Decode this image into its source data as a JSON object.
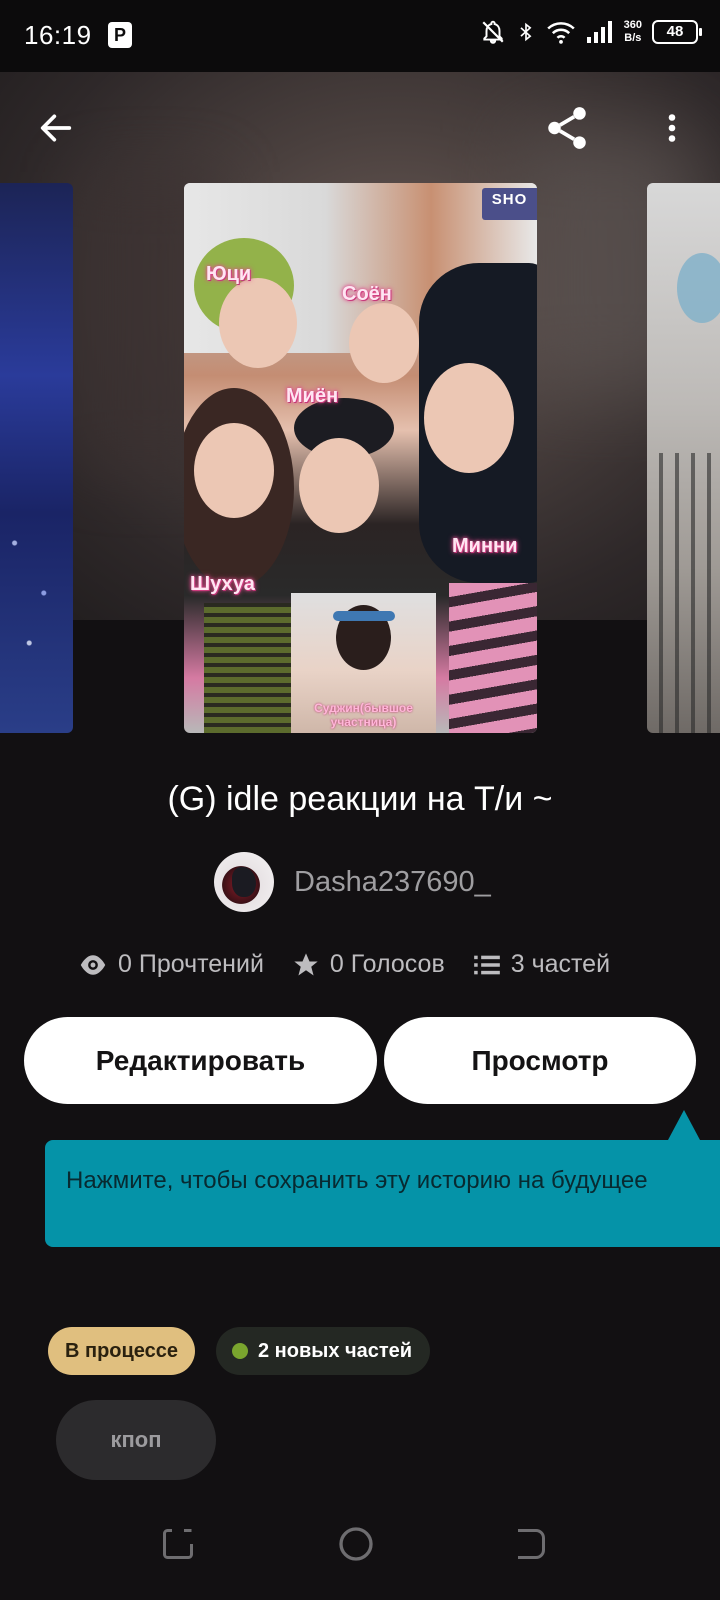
{
  "status_bar": {
    "time": "16:19",
    "app_badge": "P",
    "net_speed_value": "360",
    "net_speed_unit": "B/s",
    "battery": "48"
  },
  "header": {
    "back_icon": "arrow-left-icon",
    "share_icon": "share-icon",
    "more_icon": "more-vertical-icon"
  },
  "cover": {
    "badge": "SHO",
    "labels": [
      "Юци",
      "Соён",
      "Миён",
      "Минни",
      "Шухуа"
    ],
    "inset_caption": "Суджин(бывшое участница)"
  },
  "story": {
    "title": "(G) idle реакции на Т/и ~",
    "author": "Dasha237690_"
  },
  "stats": {
    "reads": "0 Прочтений",
    "votes": "0 Голосов",
    "parts": "3 частей"
  },
  "buttons": {
    "edit": "Редактировать",
    "view": "Просмотр"
  },
  "tooltip": {
    "text": "Нажмите, чтобы сохранить эту историю на будущее"
  },
  "tags": {
    "status": "В процессе",
    "new_parts": "2 новых частей",
    "genre": "кпоп"
  },
  "colors": {
    "background": "#121012",
    "tooltip": "#0593a8",
    "status_tag": "#e0bf7f",
    "new_dot": "#7aa52e"
  }
}
